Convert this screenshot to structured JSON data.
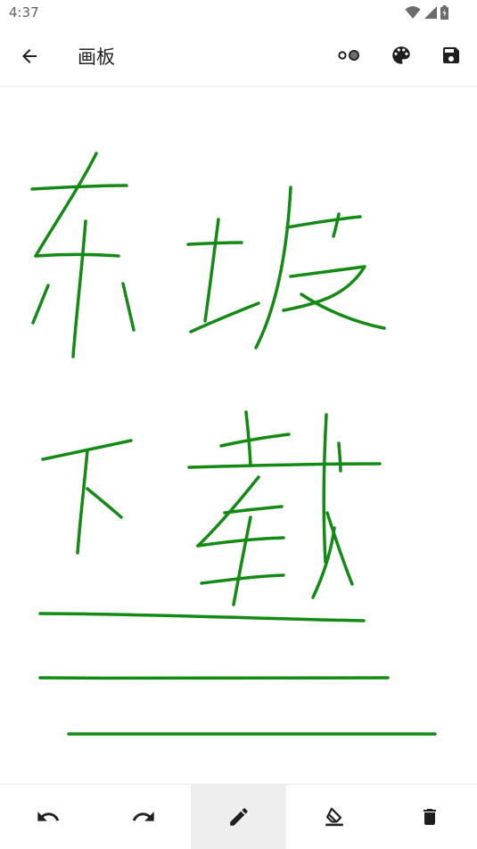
{
  "status_bar": {
    "time": "4:37"
  },
  "app_bar": {
    "title": "画板"
  },
  "tools": {
    "selected": "pen"
  },
  "colors": {
    "stroke": "#138a13",
    "icon": "#1f1f1f",
    "active_tool_bg": "#eeeeee"
  }
}
